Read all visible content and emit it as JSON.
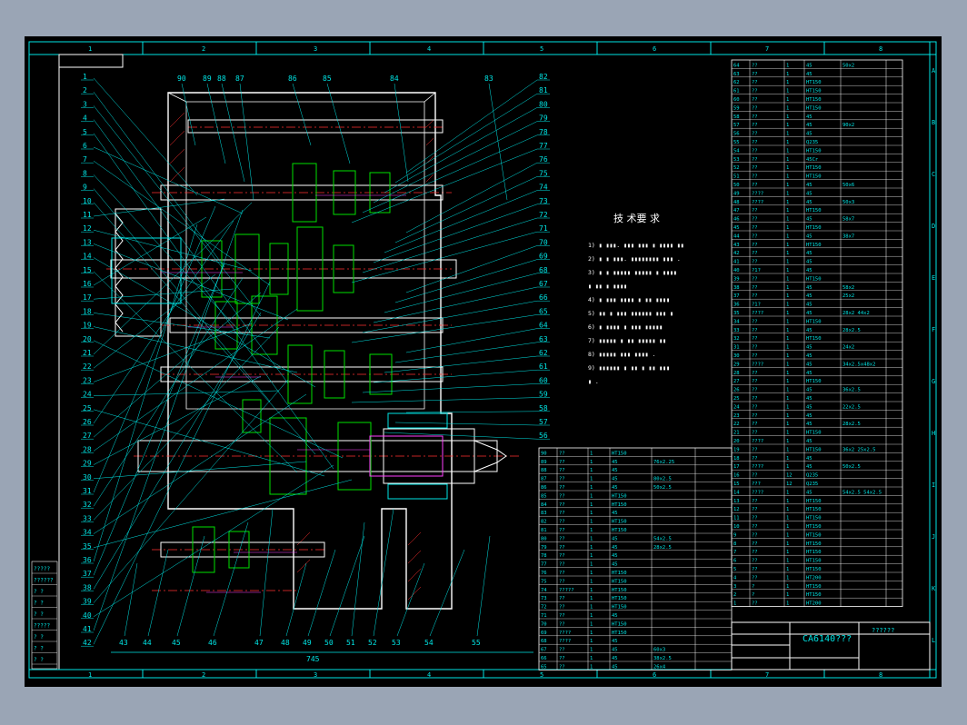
{
  "zone_cols": [
    "1",
    "2",
    "3",
    "4",
    "5",
    "6",
    "7",
    "8"
  ],
  "zone_rows": [
    "A",
    "B",
    "C",
    "D",
    "E",
    "F",
    "G",
    "H",
    "I",
    "J",
    "K",
    "L"
  ],
  "balloons_left": [
    "1",
    "2",
    "3",
    "4",
    "5",
    "6",
    "7",
    "8",
    "9",
    "10",
    "11",
    "12",
    "13",
    "14",
    "15",
    "16",
    "17",
    "18",
    "19",
    "20",
    "21",
    "22",
    "23",
    "24",
    "25",
    "26",
    "27",
    "28",
    "29",
    "30",
    "31",
    "32",
    "33",
    "34",
    "35",
    "36",
    "37",
    "38",
    "39",
    "40",
    "41",
    "42"
  ],
  "balloons_right": [
    "82",
    "81",
    "80",
    "79",
    "78",
    "77",
    "76",
    "75",
    "74",
    "73",
    "72",
    "71",
    "70",
    "69",
    "68",
    "67",
    "66",
    "65",
    "64",
    "63",
    "62",
    "61",
    "60",
    "59",
    "58",
    "57",
    "56"
  ],
  "balloons_top": [
    "90",
    "89",
    "88",
    "87",
    "86",
    "85",
    "84",
    "83"
  ],
  "balloons_bottom": [
    "43",
    "44",
    "45",
    "46",
    "47",
    "48",
    "49",
    "50",
    "51",
    "52",
    "53",
    "54",
    "55"
  ],
  "tech_req": {
    "title": "技 术要 求",
    "lines": [
      "1) ▮ ▮▮▮. ▮▮▮ ▮▮▮ ▮ ▮▮▮▮ ▮▮",
      "2) ▮ ▮ ▮▮▮. ▮▮▮▮▮▮▮▮ ▮▮▮ .",
      "3) ▮ ▮ ▮▮▮▮▮ ▮▮▮▮▮ ▮ ▮▮▮▮",
      "▮ ▮▮ ▮ ▮▮▮▮",
      "4) ▮ ▮▮▮ ▮▮▮▮ ▮ ▮▮ ▮▮▮▮",
      "5) ▮▮ ▮ ▮▮▮ ▮▮▮▮▮▮ ▮▮▮ ▮",
      "6) ▮ ▮▮▮▮ ▮ ▮▮▮ ▮▮▮▮▮",
      "7) ▮▮▮▮▮ ▮ ▮▮ ▮▮▮▮▮ ▮▮",
      "8) ▮▮▮▮▮ ▮▮▮ ▮▮▮▮ .",
      "9) ▮▮▮▮▮▮ ▮ ▮▮ ▮ ▮▮ ▮▮▮",
      "▮ ."
    ]
  },
  "drawing_title": "CA6140???",
  "title_code": "??????",
  "dimension_overall": "745",
  "left_stamp": [
    "?????",
    "??????",
    "? ?",
    "? ?",
    "? ?",
    "?????",
    "? ?",
    "? ?",
    "? ?"
  ],
  "bom_right": [
    {
      "no": "64",
      "name": "??",
      "qty": "1",
      "mat": "45",
      "note": "50x2"
    },
    {
      "no": "63",
      "name": "??",
      "qty": "1",
      "mat": "45",
      "note": ""
    },
    {
      "no": "62",
      "name": "??",
      "qty": "1",
      "mat": "HT150",
      "note": ""
    },
    {
      "no": "61",
      "name": "??",
      "qty": "1",
      "mat": "HT150",
      "note": ""
    },
    {
      "no": "60",
      "name": "??",
      "qty": "1",
      "mat": "HT150",
      "note": ""
    },
    {
      "no": "59",
      "name": "??",
      "qty": "1",
      "mat": "HT150",
      "note": ""
    },
    {
      "no": "58",
      "name": "??",
      "qty": "1",
      "mat": "45",
      "note": ""
    },
    {
      "no": "57",
      "name": "??",
      "qty": "1",
      "mat": "45",
      "note": "90x2"
    },
    {
      "no": "56",
      "name": "??",
      "qty": "1",
      "mat": "45",
      "note": ""
    },
    {
      "no": "55",
      "name": "??",
      "qty": "1",
      "mat": "Q235",
      "note": ""
    },
    {
      "no": "54",
      "name": "??",
      "qty": "1",
      "mat": "HT150",
      "note": ""
    },
    {
      "no": "53",
      "name": "??",
      "qty": "1",
      "mat": "45Cr",
      "note": ""
    },
    {
      "no": "52",
      "name": "??",
      "qty": "1",
      "mat": "HT150",
      "note": ""
    },
    {
      "no": "51",
      "name": "??",
      "qty": "1",
      "mat": "HT150",
      "note": ""
    },
    {
      "no": "50",
      "name": "??",
      "qty": "1",
      "mat": "45",
      "note": "50x6"
    },
    {
      "no": "49",
      "name": "????",
      "qty": "1",
      "mat": "45",
      "note": ""
    },
    {
      "no": "48",
      "name": "????",
      "qty": "1",
      "mat": "45",
      "note": "50x3"
    },
    {
      "no": "47",
      "name": "??",
      "qty": "1",
      "mat": "HT150",
      "note": ""
    },
    {
      "no": "46",
      "name": "??",
      "qty": "1",
      "mat": "45",
      "note": "58x7"
    },
    {
      "no": "45",
      "name": "??",
      "qty": "1",
      "mat": "HT150",
      "note": ""
    },
    {
      "no": "44",
      "name": "??",
      "qty": "1",
      "mat": "45",
      "note": "38x7"
    },
    {
      "no": "43",
      "name": "??",
      "qty": "1",
      "mat": "HT150",
      "note": ""
    },
    {
      "no": "42",
      "name": "??",
      "qty": "1",
      "mat": "45",
      "note": ""
    },
    {
      "no": "41",
      "name": "??",
      "qty": "1",
      "mat": "45",
      "note": ""
    },
    {
      "no": "40",
      "name": "?1?",
      "qty": "1",
      "mat": "45",
      "note": ""
    },
    {
      "no": "39",
      "name": "??",
      "qty": "1",
      "mat": "HT150",
      "note": ""
    },
    {
      "no": "38",
      "name": "??",
      "qty": "1",
      "mat": "45",
      "note": "58x2"
    },
    {
      "no": "37",
      "name": "??",
      "qty": "1",
      "mat": "45",
      "note": "25x2"
    },
    {
      "no": "36",
      "name": "?1?",
      "qty": "1",
      "mat": "45",
      "note": ""
    },
    {
      "no": "35",
      "name": "????",
      "qty": "1",
      "mat": "45",
      "note": "28x2 44x2"
    },
    {
      "no": "34",
      "name": "??",
      "qty": "1",
      "mat": "HT150",
      "note": ""
    },
    {
      "no": "33",
      "name": "??",
      "qty": "1",
      "mat": "45",
      "note": "28x2.5"
    },
    {
      "no": "32",
      "name": "??",
      "qty": "1",
      "mat": "HT150",
      "note": ""
    },
    {
      "no": "31",
      "name": "??",
      "qty": "1",
      "mat": "45",
      "note": "24x2"
    },
    {
      "no": "30",
      "name": "??",
      "qty": "1",
      "mat": "45",
      "note": ""
    },
    {
      "no": "29",
      "name": "????",
      "qty": "1",
      "mat": "45",
      "note": "34x2.5x48x2"
    },
    {
      "no": "28",
      "name": "??",
      "qty": "1",
      "mat": "45",
      "note": ""
    },
    {
      "no": "27",
      "name": "??",
      "qty": "1",
      "mat": "HT150",
      "note": ""
    },
    {
      "no": "26",
      "name": "??",
      "qty": "1",
      "mat": "45",
      "note": "36x2.5"
    },
    {
      "no": "25",
      "name": "??",
      "qty": "1",
      "mat": "45",
      "note": ""
    },
    {
      "no": "24",
      "name": "??",
      "qty": "1",
      "mat": "45",
      "note": "22x2.5"
    },
    {
      "no": "23",
      "name": "??",
      "qty": "1",
      "mat": "45",
      "note": ""
    },
    {
      "no": "22",
      "name": "??",
      "qty": "1",
      "mat": "45",
      "note": "28x2.5"
    },
    {
      "no": "21",
      "name": "??",
      "qty": "1",
      "mat": "HT150",
      "note": ""
    },
    {
      "no": "20",
      "name": "????",
      "qty": "1",
      "mat": "45",
      "note": ""
    },
    {
      "no": "19",
      "name": "??",
      "qty": "1",
      "mat": "HT150",
      "note": "36x2 25x2.5"
    },
    {
      "no": "18",
      "name": "??",
      "qty": "1",
      "mat": "45",
      "note": ""
    },
    {
      "no": "17",
      "name": "????",
      "qty": "1",
      "mat": "45",
      "note": "50x2.5"
    },
    {
      "no": "16",
      "name": "??",
      "qty": "12",
      "mat": "Q235",
      "note": ""
    },
    {
      "no": "15",
      "name": "???",
      "qty": "12",
      "mat": "Q235",
      "note": ""
    },
    {
      "no": "14",
      "name": "????",
      "qty": "1",
      "mat": "45",
      "note": "54x2.5 54x2.5"
    },
    {
      "no": "13",
      "name": "??",
      "qty": "1",
      "mat": "HT150",
      "note": ""
    },
    {
      "no": "12",
      "name": "??",
      "qty": "1",
      "mat": "HT150",
      "note": ""
    },
    {
      "no": "11",
      "name": "??",
      "qty": "1",
      "mat": "HT150",
      "note": ""
    },
    {
      "no": "10",
      "name": "??",
      "qty": "1",
      "mat": "HT150",
      "note": ""
    },
    {
      "no": "9",
      "name": "??",
      "qty": "1",
      "mat": "HT150",
      "note": ""
    },
    {
      "no": "8",
      "name": "??",
      "qty": "1",
      "mat": "HT150",
      "note": ""
    },
    {
      "no": "7",
      "name": "??",
      "qty": "1",
      "mat": "HT150",
      "note": ""
    },
    {
      "no": "6",
      "name": "??",
      "qty": "1",
      "mat": "HT150",
      "note": ""
    },
    {
      "no": "5",
      "name": "??",
      "qty": "1",
      "mat": "HT150",
      "note": ""
    },
    {
      "no": "4",
      "name": "??",
      "qty": "1",
      "mat": "HT200",
      "note": ""
    },
    {
      "no": "3",
      "name": "?",
      "qty": "1",
      "mat": "HT150",
      "note": ""
    },
    {
      "no": "2",
      "name": "?",
      "qty": "1",
      "mat": "HT150",
      "note": ""
    },
    {
      "no": "1",
      "name": "??",
      "qty": "1",
      "mat": "HT200",
      "note": ""
    }
  ],
  "bom_mid": [
    {
      "no": "90",
      "name": "??",
      "qty": "1",
      "mat": "HT150",
      "note": ""
    },
    {
      "no": "89",
      "name": "??",
      "qty": "1",
      "mat": "45",
      "note": "76x2.25"
    },
    {
      "no": "88",
      "name": "??",
      "qty": "1",
      "mat": "45",
      "note": ""
    },
    {
      "no": "87",
      "name": "??",
      "qty": "1",
      "mat": "45",
      "note": "80x2.5"
    },
    {
      "no": "86",
      "name": "??",
      "qty": "1",
      "mat": "45",
      "note": "50x2.5"
    },
    {
      "no": "85",
      "name": "??",
      "qty": "1",
      "mat": "HT150",
      "note": ""
    },
    {
      "no": "84",
      "name": "??",
      "qty": "1",
      "mat": "HT150",
      "note": ""
    },
    {
      "no": "83",
      "name": "??",
      "qty": "1",
      "mat": "45",
      "note": ""
    },
    {
      "no": "82",
      "name": "??",
      "qty": "1",
      "mat": "HT150",
      "note": ""
    },
    {
      "no": "81",
      "name": "??",
      "qty": "1",
      "mat": "HT150",
      "note": ""
    },
    {
      "no": "80",
      "name": "??",
      "qty": "1",
      "mat": "45",
      "note": "54x2.5"
    },
    {
      "no": "79",
      "name": "??",
      "qty": "1",
      "mat": "45",
      "note": "28x2.5"
    },
    {
      "no": "78",
      "name": "??",
      "qty": "1",
      "mat": "45",
      "note": ""
    },
    {
      "no": "77",
      "name": "??",
      "qty": "1",
      "mat": "45",
      "note": ""
    },
    {
      "no": "76",
      "name": "??",
      "qty": "1",
      "mat": "HT150",
      "note": ""
    },
    {
      "no": "75",
      "name": "??",
      "qty": "1",
      "mat": "HT150",
      "note": ""
    },
    {
      "no": "74",
      "name": "?????",
      "qty": "1",
      "mat": "HT150",
      "note": ""
    },
    {
      "no": "73",
      "name": "??",
      "qty": "1",
      "mat": "HT150",
      "note": ""
    },
    {
      "no": "72",
      "name": "??",
      "qty": "1",
      "mat": "HT150",
      "note": ""
    },
    {
      "no": "71",
      "name": "??",
      "qty": "1",
      "mat": "45",
      "note": ""
    },
    {
      "no": "70",
      "name": "??",
      "qty": "1",
      "mat": "HT150",
      "note": ""
    },
    {
      "no": "69",
      "name": "????",
      "qty": "1",
      "mat": "HT150",
      "note": ""
    },
    {
      "no": "68",
      "name": "????",
      "qty": "1",
      "mat": "45",
      "note": ""
    },
    {
      "no": "67",
      "name": "??",
      "qty": "1",
      "mat": "45",
      "note": "60x3"
    },
    {
      "no": "66",
      "name": "??",
      "qty": "1",
      "mat": "45",
      "note": "38x2.5"
    },
    {
      "no": "65",
      "name": "??",
      "qty": "1",
      "mat": "45",
      "note": "26x4"
    }
  ]
}
